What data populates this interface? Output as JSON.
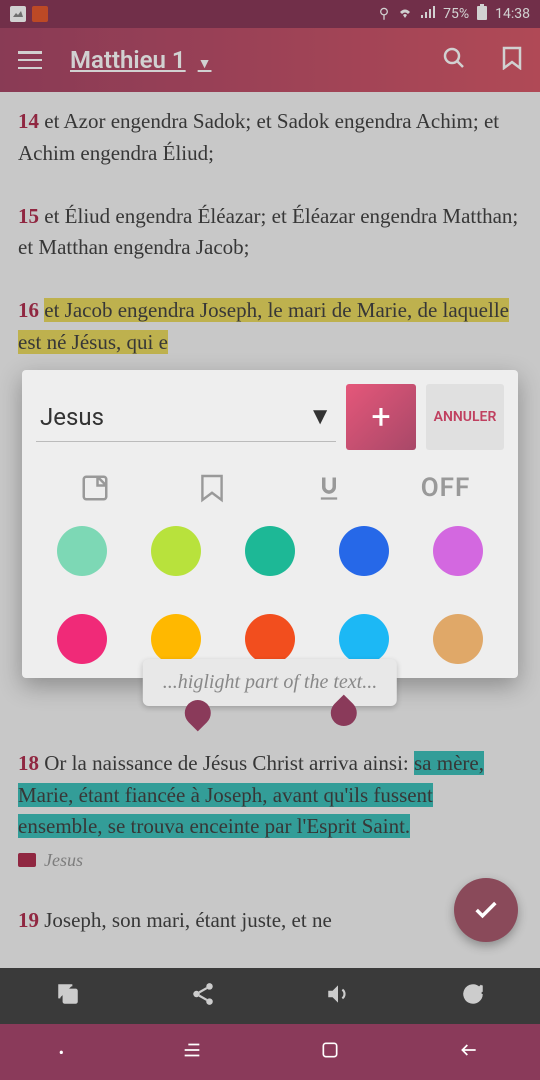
{
  "status": {
    "time": "14:38",
    "battery": "75%"
  },
  "header": {
    "title": "Matthieu 1"
  },
  "verses": [
    {
      "num": "14",
      "text": "et Azor engendra Sadok; et Sadok engendra Achim; et Achim engendra Éliud;"
    },
    {
      "num": "15",
      "text": "et Éliud engendra Éléazar; et Éléazar engendra Matthan; et Matthan engendra Jacob;"
    },
    {
      "num": "16",
      "text_hl": "et Jacob engendra Joseph, le mari de Marie, de laquelle est né Jésus, qui e"
    },
    {
      "num": "18",
      "pre": "Or la naissance de Jésus Christ arriva ainsi: ",
      "hl": "sa mère, Marie, étant fiancée à Joseph, avant qu'ils fussent ensemble, se trouva enceinte par l'Esprit Saint."
    },
    {
      "num": "19",
      "text": "Joseph, son mari, étant juste, et ne"
    }
  ],
  "tag": "Jesus",
  "dialog": {
    "dropdown_value": "Jesus",
    "add_label": "+",
    "cancel_label": "ANNULER",
    "off_label": "OFF",
    "toast": "...higlight part of the text...",
    "colors_row1": [
      "#7dd8b5",
      "#b8e23c",
      "#1db896",
      "#2668e8",
      "#d368e0"
    ],
    "colors_row2": [
      "#f02a78",
      "#ffb800",
      "#f24e1e",
      "#1cb8f5",
      "#e0a868"
    ]
  }
}
